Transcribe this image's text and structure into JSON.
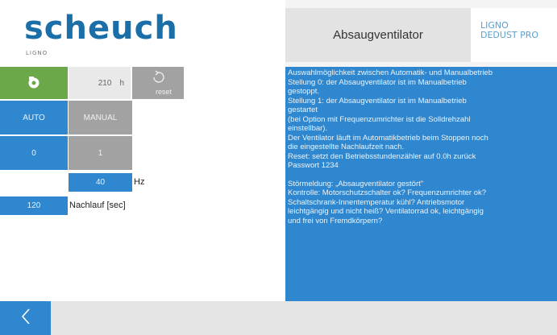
{
  "header": {
    "logo_text": "scheuch",
    "logo_subtext": "LIGNO",
    "title": "Absaugventilator",
    "brand_line1": "LIGNO",
    "brand_line2": "DEDUST PRO"
  },
  "fan": {
    "status_icon": "fan-icon",
    "status_color": "#6ba84a",
    "hours_value": "210",
    "hours_unit": "h",
    "reset_label": "reset"
  },
  "mode": {
    "auto_label": "AUTO",
    "manual_label": "MANUAL"
  },
  "stage": {
    "off_label": "0",
    "on_label": "1"
  },
  "frequency": {
    "value": "40",
    "unit": "Hz"
  },
  "overrun": {
    "value": "120",
    "label": "Nachlauf [sec]"
  },
  "help": {
    "lines": [
      "Auswahlmöglichkeit zwischen Automatik- und Manualbetrieb",
      "Stellung 0: der Absaugventilator ist im Manualbetrieb",
      "gestoppt.",
      "Stellung 1: der Absaugventilator ist im Manualbetrieb",
      "gestartet",
      "(bei Option mit Frequenzumrichter ist die Solldrehzahl",
      "einstellbar).",
      "Der Ventilator läuft im Automatikbetrieb beim Stoppen noch",
      "die eingestellte Nachlaufzeit nach.",
      "Reset: setzt den Betriebsstundenzähler auf 0.0h zurück",
      "Passwort 1234",
      "",
      "Störmeldung: „Absaugventilator gestört\"",
      "Kontrolle: Motorschutzschalter ok? Frequenzumrichter ok?",
      "Schaltschrank-Innentemperatur kühl? Antriebsmotor",
      "leichtgängig und nicht heiß? Ventilatorrad ok, leichtgängig",
      "und frei von Fremdkörpern?"
    ]
  },
  "footer": {
    "back_icon": "chevron-left-icon"
  },
  "colors": {
    "accent_blue": "#2f87cf",
    "logo_blue": "#1a6fa8",
    "button_grey": "#a2a2a2",
    "status_green": "#6ba84a"
  }
}
